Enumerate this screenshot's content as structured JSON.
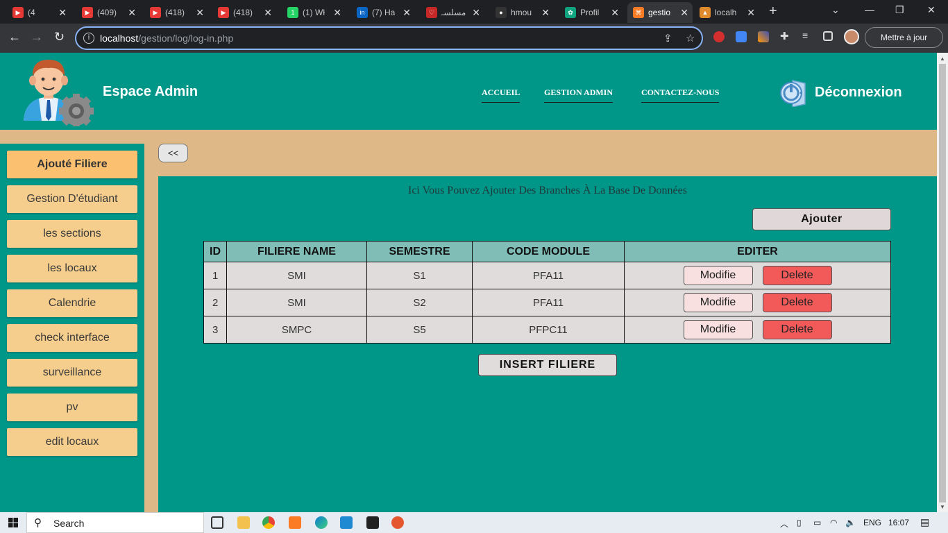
{
  "browser": {
    "tabs": [
      {
        "label": "(4",
        "color": "#e53935",
        "glyph": "▶"
      },
      {
        "label": "(409)",
        "color": "#e53935",
        "glyph": "▶"
      },
      {
        "label": "(418)",
        "color": "#e53935",
        "glyph": "▶"
      },
      {
        "label": "(418)",
        "color": "#e53935",
        "glyph": "▶"
      },
      {
        "label": "(1) Wł",
        "color": "#25d366",
        "glyph": "1"
      },
      {
        "label": "(7) Ha",
        "color": "#0a66c2",
        "glyph": "in"
      },
      {
        "label": "مسلسـ",
        "color": "#c62828",
        "glyph": "♡"
      },
      {
        "label": "hmou",
        "color": "#333",
        "glyph": "●"
      },
      {
        "label": "Profil",
        "color": "#10a37f",
        "glyph": "✿"
      },
      {
        "label": "gestio",
        "color": "#fb7a24",
        "glyph": "⌘"
      },
      {
        "label": "localh",
        "color": "#e08a2e",
        "glyph": "▲"
      }
    ],
    "url_host": "localhost",
    "url_path": "/gestion/log/log-in.php",
    "update_label": "Mettre à jour"
  },
  "header": {
    "brand": "Espace Admin",
    "nav": [
      "ACCUEIL",
      "GESTION ADMIN",
      "CONTACTEZ-NOUS"
    ],
    "logout": "Déconnexion"
  },
  "sidebar": {
    "items": [
      "Ajouté Filiere",
      "Gestion D'étudiant",
      "les sections",
      "les locaux",
      "Calendrie",
      "check interface",
      "surveillance",
      "pv",
      "edit locaux"
    ]
  },
  "main": {
    "back_label": "<<",
    "info": "Ici Vous Pouvez Ajouter Des Branches À La Base De Données",
    "ajouter_label": "Ajouter",
    "insert_label": "INSERT FILIERE",
    "columns": [
      "ID",
      "FILIERE NAME",
      "SEMESTRE",
      "CODE MODULE",
      "EDITER"
    ],
    "rows": [
      {
        "id": "1",
        "name": "SMI",
        "semestre": "S1",
        "code": "PFA11"
      },
      {
        "id": "2",
        "name": "SMI",
        "semestre": "S2",
        "code": "PFA11"
      },
      {
        "id": "3",
        "name": "SMPC",
        "semestre": "S5",
        "code": "PFPC11"
      }
    ],
    "modify_label": "Modifie",
    "delete_label": "Delete"
  },
  "taskbar": {
    "search": "Search",
    "lang": "ENG",
    "time": "16:07"
  }
}
